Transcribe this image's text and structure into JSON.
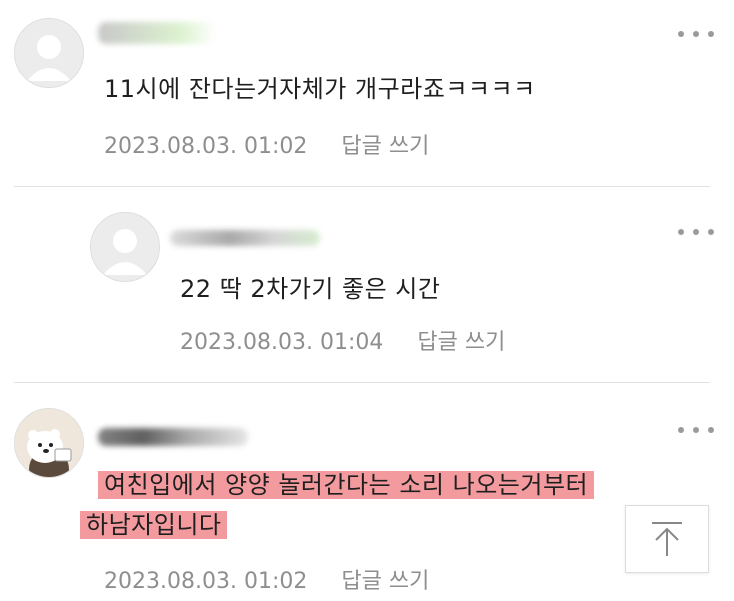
{
  "comments": [
    {
      "text": "11시에 잔다는거자체가 개구라죠ㅋㅋㅋㅋ",
      "date": "2023.08.03. 01:02",
      "reply_label": "답글 쓰기"
    },
    {
      "text": "22 딱 2차가기 좋은 시간",
      "date": "2023.08.03. 01:04",
      "reply_label": "답글 쓰기"
    },
    {
      "text_line1": "여친입에서 양양 놀러간다는 소리 나오는거부터",
      "text_line2": "하남자입니다",
      "date": "2023.08.03. 01:02",
      "reply_label": "답글 쓰기"
    }
  ],
  "icons": {
    "more": "more-dots-icon",
    "avatar_default": "default-avatar-icon",
    "avatar_bear": "polar-bear-avatar-icon",
    "scroll_top": "arrow-up-icon"
  },
  "colors": {
    "highlight": "#f39a9e",
    "meta_text": "#8e8e8e",
    "divider": "#e3e3e3"
  }
}
